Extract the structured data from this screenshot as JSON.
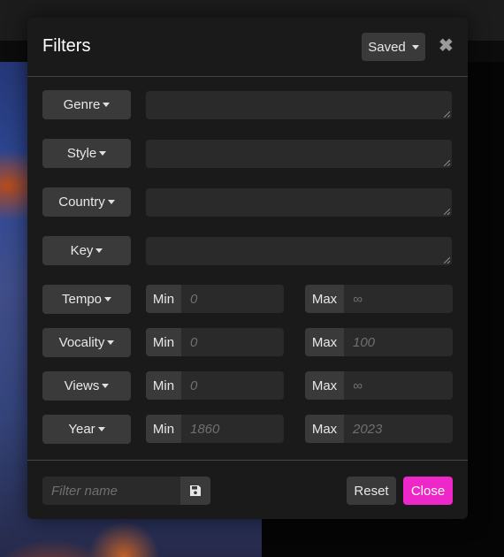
{
  "modal": {
    "title": "Filters",
    "saved_label": "Saved",
    "close_symbol": "✖"
  },
  "text_filters": [
    {
      "label": "Genre",
      "value": ""
    },
    {
      "label": "Style",
      "value": ""
    },
    {
      "label": "Country",
      "value": ""
    },
    {
      "label": "Key",
      "value": ""
    }
  ],
  "range_filters": [
    {
      "label": "Tempo",
      "min_label": "Min",
      "min_placeholder": "0",
      "max_label": "Max",
      "max_placeholder": "∞"
    },
    {
      "label": "Vocality",
      "min_label": "Min",
      "min_placeholder": "0",
      "max_label": "Max",
      "max_placeholder": "100"
    },
    {
      "label": "Views",
      "min_label": "Min",
      "min_placeholder": "0",
      "max_label": "Max",
      "max_placeholder": "∞"
    },
    {
      "label": "Year",
      "min_label": "Min",
      "min_placeholder": "1860",
      "max_label": "Max",
      "max_placeholder": "2023"
    }
  ],
  "footer": {
    "filter_name_placeholder": "Filter name",
    "save_icon": "floppy-disk-icon",
    "reset_label": "Reset",
    "close_label": "Close"
  },
  "colors": {
    "accent": "#ee28c8",
    "modal_bg": "#1a1a1a",
    "button_bg": "#3a3a3a",
    "input_bg": "#2a2a2a"
  }
}
